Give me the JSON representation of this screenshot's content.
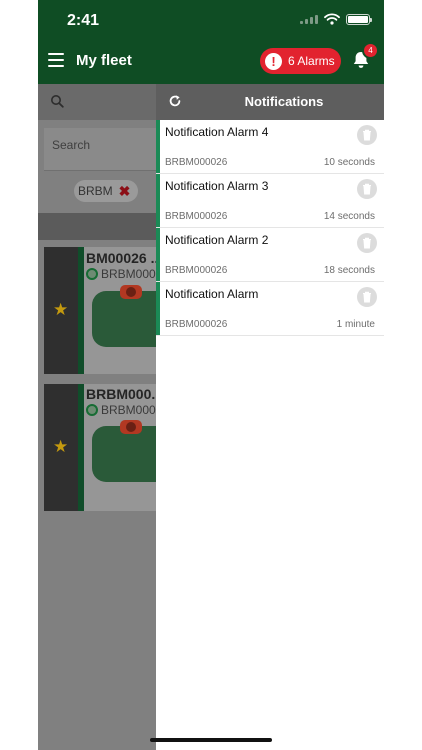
{
  "status": {
    "time": "2:41"
  },
  "app_bar": {
    "title": "My fleet",
    "alarms_label": "6 Alarms",
    "alarm_icon_glyph": "!",
    "bell_badge": "4"
  },
  "background": {
    "search_label": "Search",
    "filter_chip": "BRBM",
    "chip_remove_glyph": "✖",
    "star_glyph": "★",
    "robots": [
      {
        "code": "BM00026 ...",
        "serial": "BRBM000"
      },
      {
        "code": "BRBM000...",
        "serial": "BRBM000"
      }
    ]
  },
  "panel": {
    "title": "Notifications",
    "items": [
      {
        "title": "Notification Alarm 4",
        "serial": "BRBM000026",
        "time": "10 seconds"
      },
      {
        "title": "Notification Alarm 3",
        "serial": "BRBM000026",
        "time": "14 seconds"
      },
      {
        "title": "Notification Alarm 2",
        "serial": "BRBM000026",
        "time": "18 seconds"
      },
      {
        "title": "Notification Alarm",
        "serial": "BRBM000026",
        "time": "1 minute"
      }
    ]
  },
  "colors": {
    "header_green": "#0f4d24",
    "alarm_red": "#e2232f",
    "accent_green": "#1b8a56",
    "panel_header": "#5e5e5e"
  },
  "icons": [
    "menu-icon",
    "alert-icon",
    "bell-icon",
    "search-icon",
    "refresh-icon",
    "trash-icon",
    "star-icon",
    "gps-icon",
    "wifi-icon",
    "battery-icon"
  ]
}
